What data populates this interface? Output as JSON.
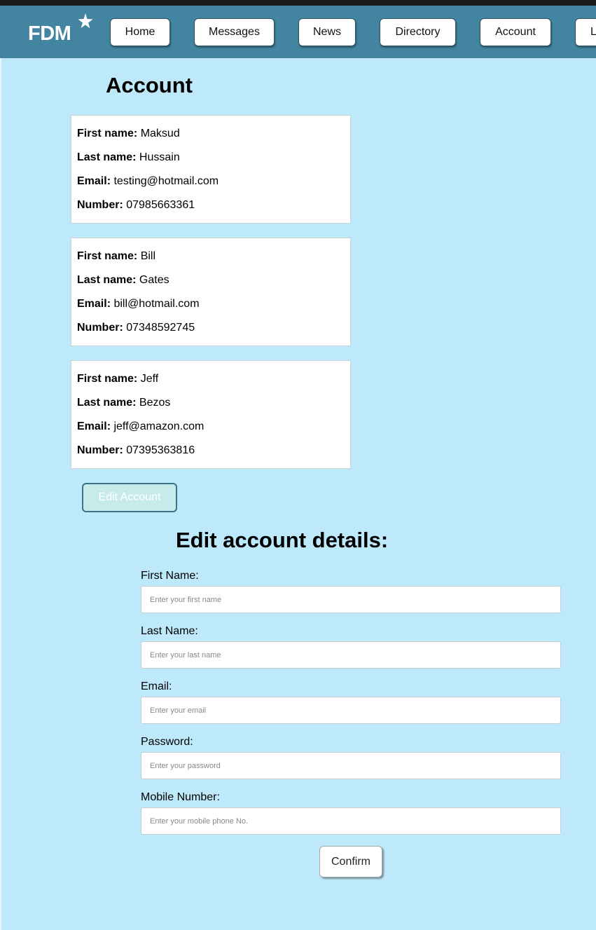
{
  "logo": {
    "text": "FDM"
  },
  "nav": {
    "items": [
      {
        "label": "Home"
      },
      {
        "label": "Messages"
      },
      {
        "label": "News"
      },
      {
        "label": "Directory"
      },
      {
        "label": "Account"
      },
      {
        "label": "L"
      }
    ]
  },
  "page": {
    "title": "Account"
  },
  "field_labels": {
    "first_name": "First name:",
    "last_name": "Last name:",
    "email": "Email:",
    "number": "Number:"
  },
  "accounts": [
    {
      "first_name": "Maksud",
      "last_name": "Hussain",
      "email": "testing@hotmail.com",
      "number": "07985663361"
    },
    {
      "first_name": "Bill",
      "last_name": "Gates",
      "email": "bill@hotmail.com",
      "number": "07348592745"
    },
    {
      "first_name": "Jeff",
      "last_name": "Bezos",
      "email": "jeff@amazon.com",
      "number": "07395363816"
    }
  ],
  "edit_button": {
    "label": "Edit Account"
  },
  "form": {
    "title": "Edit account details:",
    "fields": [
      {
        "label": "First Name:",
        "placeholder": "Enter your first name",
        "value": ""
      },
      {
        "label": "Last Name:",
        "placeholder": "Enter your last name",
        "value": ""
      },
      {
        "label": "Email:",
        "placeholder": "Enter your email",
        "value": ""
      },
      {
        "label": "Password:",
        "placeholder": "Enter your password",
        "value": ""
      },
      {
        "label": "Mobile Number:",
        "placeholder": "Enter your mobile phone No.",
        "value": ""
      }
    ],
    "confirm_label": "Confirm"
  },
  "colors": {
    "background": "#bde9fa",
    "navbar": "#4385a0",
    "card": "#ffffff",
    "edit_button": "#c7ebea"
  },
  "icons": {
    "logo_star": "star-icon"
  }
}
